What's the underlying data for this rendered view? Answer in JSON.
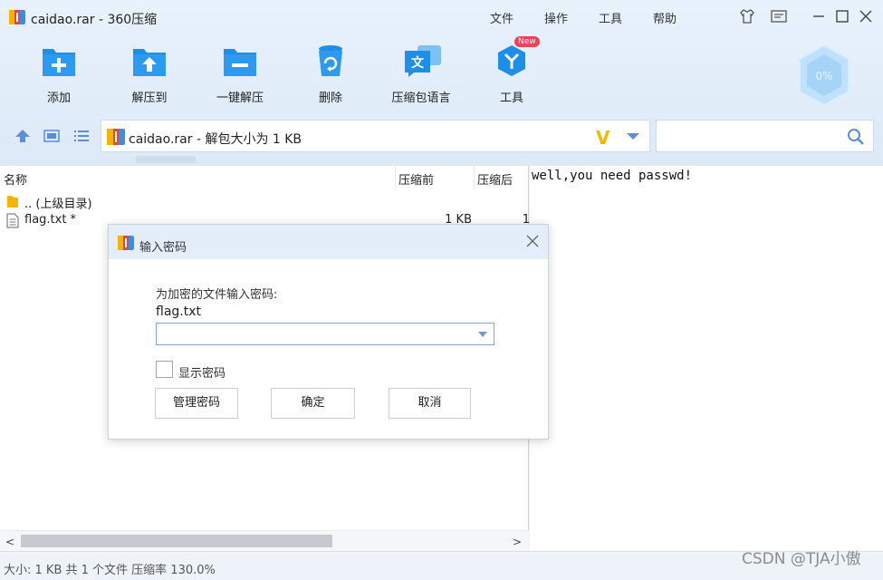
{
  "window": {
    "title": "caidao.rar - 360压缩",
    "menu": [
      "文件",
      "操作",
      "工具",
      "帮助"
    ]
  },
  "toolbar": {
    "items": [
      {
        "label": "添加",
        "icon": "add-icon"
      },
      {
        "label": "解压到",
        "icon": "extract-to-icon"
      },
      {
        "label": "一键解压",
        "icon": "one-click-extract-icon"
      },
      {
        "label": "删除",
        "icon": "delete-icon"
      },
      {
        "label": "压缩包语言",
        "icon": "archive-language-icon"
      },
      {
        "label": "工具",
        "icon": "tools-icon",
        "badge": "New"
      }
    ],
    "progress_text": "0%"
  },
  "address": {
    "path": "caidao.rar - 解包大小为 1 KB",
    "search_placeholder": ""
  },
  "file_list": {
    "columns": [
      "名称",
      "压缩前",
      "压缩后"
    ],
    "rows": [
      {
        "name": ".. (上级目录)",
        "size": "",
        "packed": "",
        "icon": "folder-icon"
      },
      {
        "name": "flag.txt *",
        "size": "1 KB",
        "packed": "1",
        "icon": "text-file-icon"
      }
    ],
    "scroll_left": "<",
    "scroll_right": ">"
  },
  "preview": {
    "text": "well,you need passwd!"
  },
  "status": {
    "text": "大小: 1 KB 共 1 个文件 压缩率 130.0%",
    "watermark": "CSDN @TJA小傲"
  },
  "dialog": {
    "title": "输入密码",
    "prompt": "为加密的文件输入密码:",
    "filename": "flag.txt",
    "password_value": "",
    "show_password_label": "显示密码",
    "buttons": {
      "manage": "管理密码",
      "ok": "确定",
      "cancel": "取消"
    }
  },
  "colors": {
    "accent": "#1e8fe8",
    "toolbar_bg": "#e8f2fd",
    "badge": "#f0405a"
  }
}
